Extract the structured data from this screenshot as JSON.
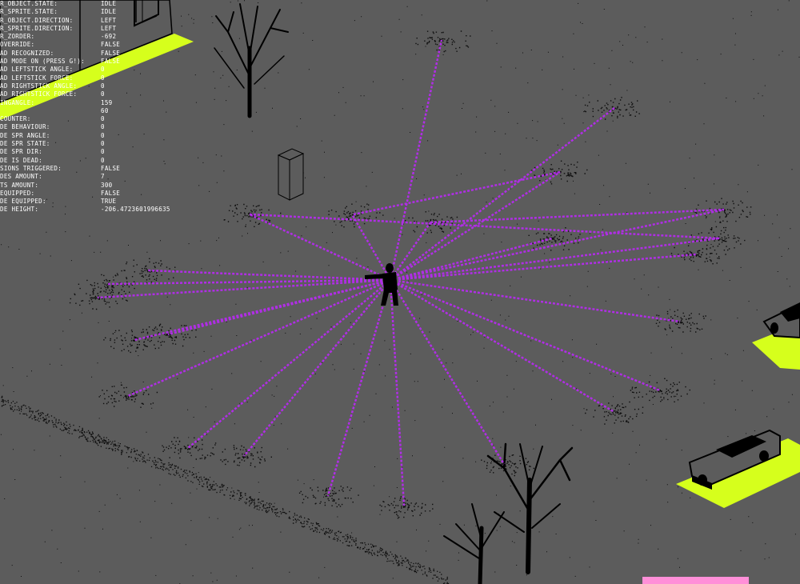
{
  "debug": {
    "rows": [
      {
        "label": "R_OBJECT.STATE:",
        "value": "IDLE"
      },
      {
        "label": "R_SPRITE.STATE:",
        "value": "IDLE"
      },
      {
        "label": "R_OBJECT.DIRECTION:",
        "value": "LEFT"
      },
      {
        "label": "R_SPRITE.DIRECTION:",
        "value": "LEFT"
      },
      {
        "label": "R_ZORDER:",
        "value": "-692"
      },
      {
        "label": " OVERRIDE:",
        "value": "FALSE"
      },
      {
        "label": "AD RECOGNIZED:",
        "value": "FALSE"
      },
      {
        "label": "AD MODE ON (PRESS G!):",
        "value": "FALSE"
      },
      {
        "label": "AD LEFTSTICK ANGLE:",
        "value": "0"
      },
      {
        "label": "AD LEFTSTICK FORCE:",
        "value": "0"
      },
      {
        "label": "AD RIGHTSTICK ANGLE:",
        "value": "0"
      },
      {
        "label": "AD RIGHTSTICK FORCE:",
        "value": "0"
      },
      {
        "label": "INGANGLE:",
        "value": "159"
      },
      {
        "label": "",
        "value": "60"
      },
      {
        "label": " COUNTER:",
        "value": "0"
      },
      {
        "label": "DE BEHAVIOUR:",
        "value": "0"
      },
      {
        "label": "DE SPR ANGLE:",
        "value": "0"
      },
      {
        "label": "DE SPR STATE:",
        "value": "0"
      },
      {
        "label": "DE SPR DIR:",
        "value": "0"
      },
      {
        "label": "DE IS DEAD:",
        "value": "0"
      },
      {
        "label": "SIONS TRIGGERED:",
        "value": "FALSE"
      },
      {
        "label": "DES AMOUNT:",
        "value": "7"
      },
      {
        "label": "TS AMOUNT:",
        "value": "300"
      },
      {
        "label": "EQUIPPED:",
        "value": "FALSE"
      },
      {
        "label": "DE EQUIPPED:",
        "value": "TRUE"
      },
      {
        "label": "DE HEIGHT:",
        "value": "-206.4723601996635"
      }
    ]
  },
  "colors": {
    "ground": "#5c5c5c",
    "ray": "#b02ee6",
    "highlight": "#d6ff1c",
    "bar": "#ff8fd8",
    "debug_text": "#ffffff"
  }
}
